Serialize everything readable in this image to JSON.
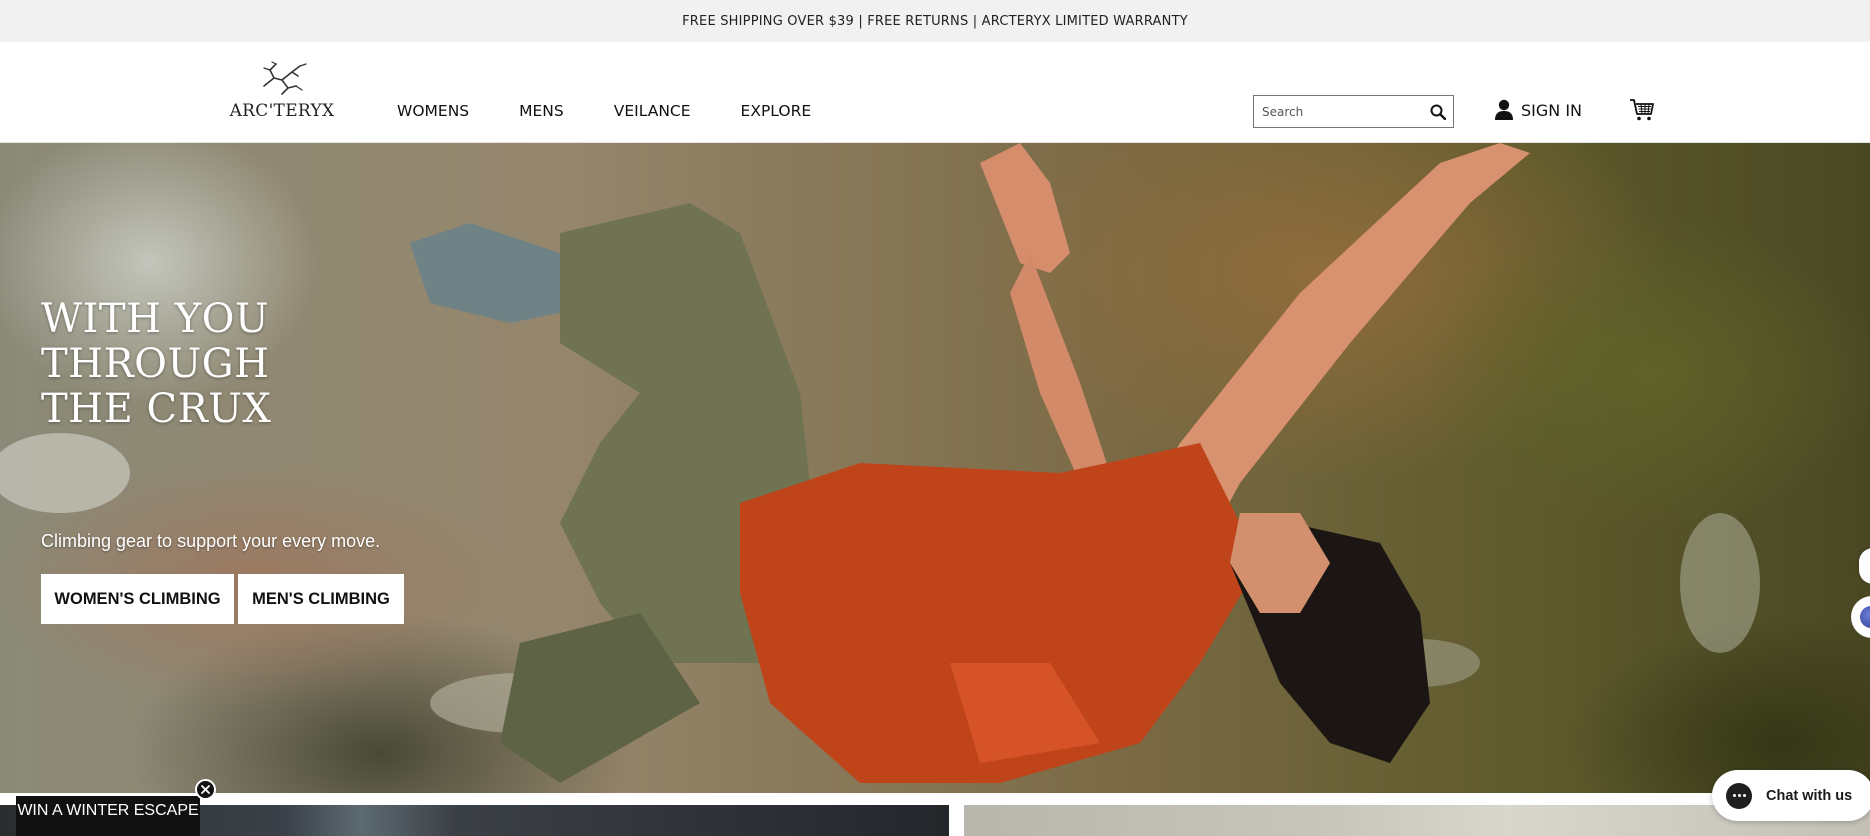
{
  "announcement": "FREE SHIPPING OVER $39  |  FREE RETURNS  |  ARCTERYX LIMITED WARRANTY",
  "brand": {
    "wordmark": "ARC'TERYX",
    "logo_icon": "archaeopteryx-logo-icon"
  },
  "nav": {
    "items": [
      "WOMENS",
      "MENS",
      "VEILANCE",
      "EXPLORE"
    ]
  },
  "search": {
    "placeholder": "Search",
    "value": "",
    "icon": "search-icon"
  },
  "account": {
    "signin_label": "SIGN IN",
    "icon": "user-icon"
  },
  "cart": {
    "icon": "cart-icon"
  },
  "hero": {
    "title_lines": [
      "WITH YOU",
      "THROUGH",
      "THE CRUX"
    ],
    "subtitle": "Climbing gear to support your every move.",
    "buttons": [
      "WOMEN'S CLIMBING",
      "MEN'S CLIMBING"
    ]
  },
  "promo": {
    "label": "WIN A WINTER ESCAPE",
    "close_icon": "close-icon"
  },
  "chat": {
    "label": "Chat with us",
    "icon": "chat-bubble-icon"
  },
  "colors": {
    "announcement_bg": "#f1f1f1",
    "button_bg": "#ffffff",
    "promo_bg": "#111111",
    "shirt": "#c0441a"
  }
}
